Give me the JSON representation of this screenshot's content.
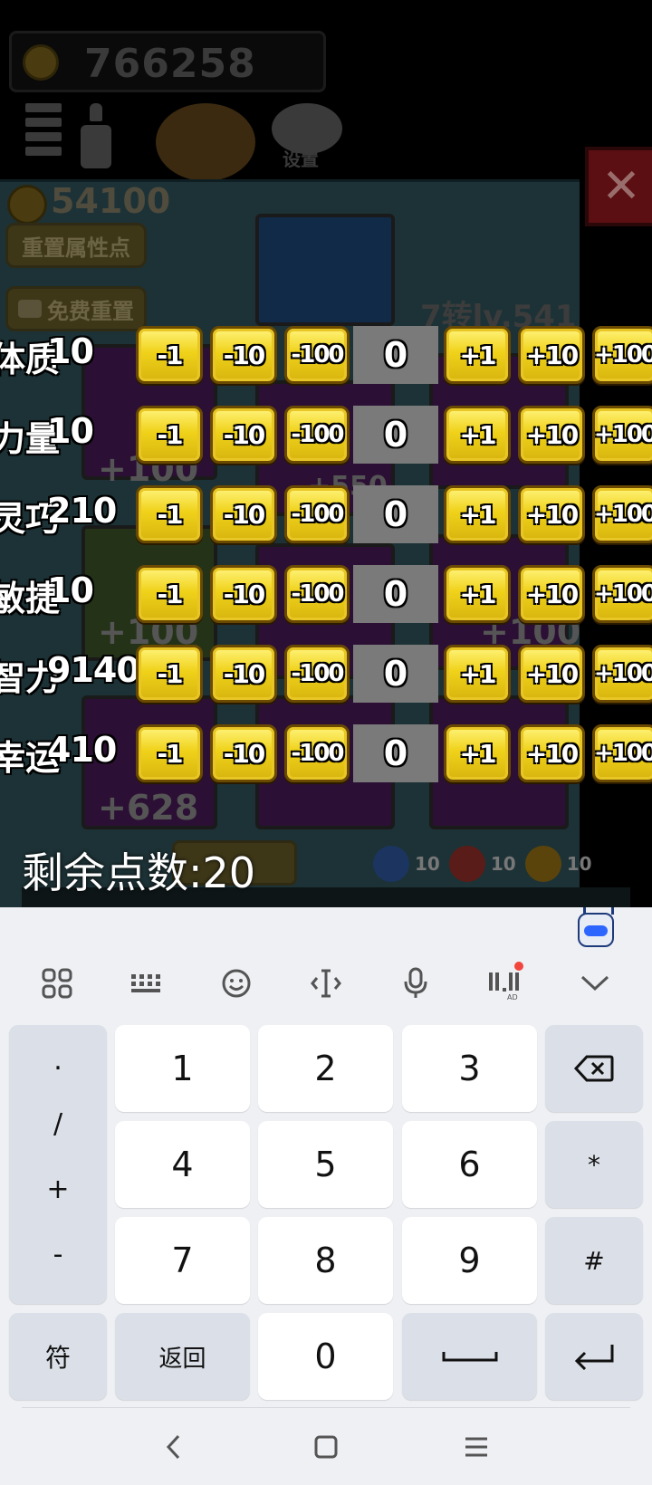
{
  "game": {
    "top_gold": "766258",
    "settings_label": "设置",
    "panel_gold": "54100",
    "reset_points_label": "重置属性点",
    "free_reset_label": "免费重置",
    "level_label": "7转lv.541",
    "slot_bonuses": [
      "+100",
      "+550",
      "+100",
      "+100",
      "+628"
    ],
    "resources": [
      {
        "icon": "water-drop-icon",
        "count": "10",
        "color": "#3d6fc0"
      },
      {
        "icon": "clock-icon",
        "count": "10",
        "color": "#c03d2c"
      },
      {
        "icon": "lightning-icon",
        "count": "10",
        "color": "#c0931c"
      }
    ],
    "close_glyph": "✕"
  },
  "stats": [
    {
      "label": "体质",
      "value": "10",
      "input": "0"
    },
    {
      "label": "力量",
      "value": "10",
      "input": "0"
    },
    {
      "label": "灵巧",
      "value": "210",
      "input": "0"
    },
    {
      "label": "敏捷",
      "value": "10",
      "input": "0"
    },
    {
      "label": "智力",
      "value": "9140",
      "input": "0"
    },
    {
      "label": "幸运",
      "value": "410",
      "input": "0"
    }
  ],
  "step_buttons": [
    "-1",
    "-10",
    "-100",
    "+1",
    "+10",
    "+100"
  ],
  "remaining_points": "剩余点数:20",
  "keyboard": {
    "symbols": [
      ".",
      "/",
      "+",
      "-"
    ],
    "digits": [
      "1",
      "2",
      "3",
      "4",
      "5",
      "6",
      "7",
      "8",
      "9",
      "0"
    ],
    "star": "*",
    "hash": "#",
    "symbol_key": "符",
    "back_key": "返回",
    "ad_label": "AD"
  }
}
